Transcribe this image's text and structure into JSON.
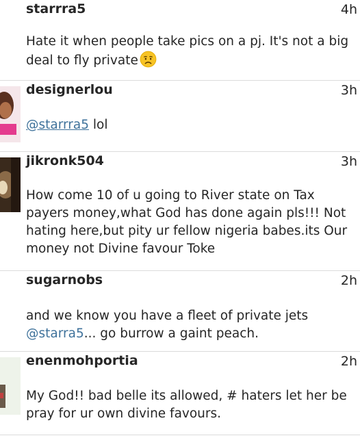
{
  "comments": [
    {
      "username": "starrra5",
      "time": "4h",
      "text_line1": "Hate it when people take pics on a pj. It's not a big",
      "text_line2": "deal to fly private",
      "emoji": "frowning-face-emoji"
    },
    {
      "username": "designerlou",
      "time": "3h",
      "mention": "@starrra5",
      "text": " lol"
    },
    {
      "username": "jikronk504",
      "time": "3h",
      "text": "How come 10 of u going to River state on Tax payers money,what God has done again pls!!! Not hating here,but pity ur fellow nigeria babes.its Our money not Divine favour Toke"
    },
    {
      "username": "sugarnobs",
      "time": "2h",
      "text_line1": "and we know you have a fleet of private jets",
      "mention": "@starra5",
      "text_line2_rest": "... go burrow a gaint peach."
    },
    {
      "username": "enenmohportia",
      "time": "2h",
      "text": "My God!! bad belle its allowed, # haters let her be pray for ur own divine favours."
    }
  ],
  "colors": {
    "mention": "#3f729b",
    "divider": "#dbdbdb",
    "text": "#262626"
  }
}
